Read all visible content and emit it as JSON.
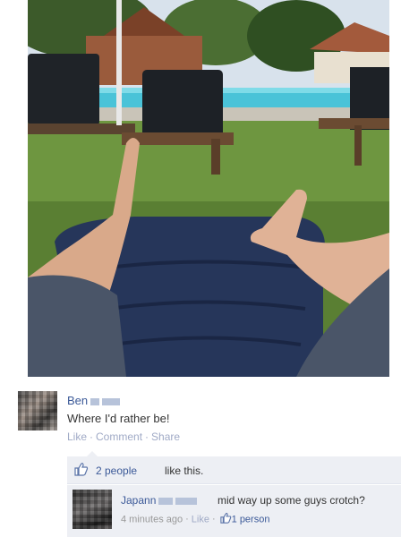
{
  "post": {
    "author": "Ben",
    "text": "Where I'd rather be!",
    "actions": {
      "like": "Like",
      "comment": "Comment",
      "share": "Share",
      "sep": "·"
    }
  },
  "likes": {
    "count": "2 people",
    "suffix": "like this."
  },
  "comment": {
    "author": "Japann",
    "text": "mid way up some guys crotch?",
    "time": "4 minutes ago",
    "like": "Like",
    "sep": "·",
    "likes": "1 person"
  },
  "colors": {
    "link": "#3b5998",
    "faded": "#a0aac6",
    "box": "#edeff4"
  }
}
